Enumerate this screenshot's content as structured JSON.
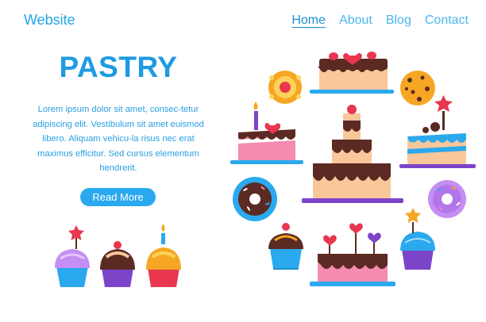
{
  "header": {
    "logo": "Website",
    "nav": [
      {
        "label": "Home",
        "active": true
      },
      {
        "label": "About"
      },
      {
        "label": "Blog"
      },
      {
        "label": "Contact"
      }
    ]
  },
  "hero": {
    "title": "PASTRY",
    "body": "Lorem ipsum dolor sit amet, consec-tetur adipiscing elit. Vestibulum sit amet euismod libero. Aliquam vehicu-la risus nec erat maximus efficitur. Sed cursus elementum hendrerit.",
    "cta_label": "Read More"
  },
  "colors": {
    "accent": "#22a6e8",
    "chocolate": "#5a2a23",
    "sponge": "#f9c79a",
    "pink": "#f58bb0",
    "cherry": "#e8374f",
    "plate_blue": "#2aa9ee",
    "plate_purple": "#7c45c9"
  },
  "illustrations": [
    "cupcake-icon",
    "cake-icon",
    "cookie-icon",
    "donut-icon",
    "candle-icon",
    "star-icon",
    "heart-icon",
    "cherry-icon"
  ]
}
